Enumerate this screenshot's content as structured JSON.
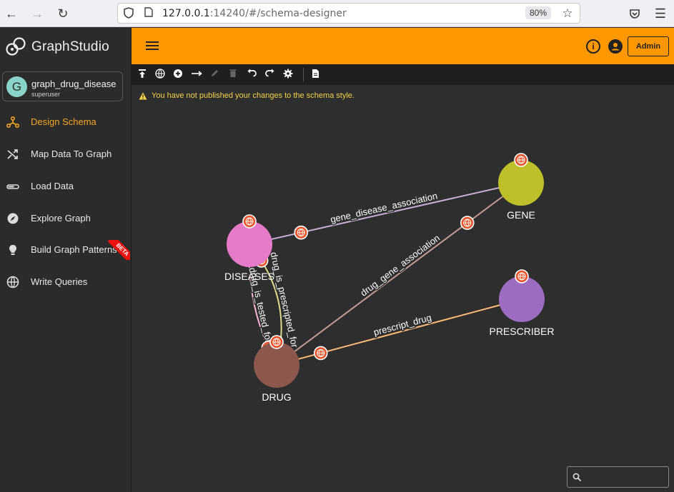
{
  "browser": {
    "url_host": "127.0.0.1",
    "url_port": ":14240",
    "url_path": "/#/schema-designer",
    "zoom": "80%"
  },
  "app": {
    "logo_prefix": "Graph",
    "logo_suffix": "Studio"
  },
  "graph": {
    "avatar_letter": "G",
    "name": "graph_drug_disease",
    "role": "superuser"
  },
  "sidebar": {
    "items": [
      {
        "label": "Design Schema",
        "icon": "schema-icon",
        "active": true
      },
      {
        "label": "Map Data To Graph",
        "icon": "shuffle-icon"
      },
      {
        "label": "Load Data",
        "icon": "load-icon"
      },
      {
        "label": "Explore Graph",
        "icon": "compass-icon"
      },
      {
        "label": "Build Graph Patterns",
        "icon": "lightbulb-icon",
        "badge": "BETA"
      },
      {
        "label": "Write Queries",
        "icon": "globe-icon"
      }
    ]
  },
  "header": {
    "admin_label": "Admin"
  },
  "toolbar": {
    "warning": "You have not published your changes to the schema style."
  },
  "schema": {
    "vertices": [
      {
        "id": "GENE",
        "label": "GENE",
        "color": "#bec02a"
      },
      {
        "id": "DISEASES",
        "label": "DISEASES",
        "color": "#e57ac8"
      },
      {
        "id": "PRESCRIBER",
        "label": "PRESCRIBER",
        "color": "#9b6cc0"
      },
      {
        "id": "DRUG",
        "label": "DRUG",
        "color": "#8c574c"
      }
    ],
    "edges": [
      {
        "label": "gene_disease_association",
        "from": "DISEASES",
        "to": "GENE",
        "color": "#c6b0d6"
      },
      {
        "label": "drug_gene_association",
        "from": "DRUG",
        "to": "GENE",
        "color": "#c49c94"
      },
      {
        "label": "prescript_drug",
        "from": "DRUG",
        "to": "PRESCRIBER",
        "color": "#ffbb78"
      },
      {
        "label": "drug_is_prescripted_for",
        "from": "DRUG",
        "to": "DISEASES",
        "color": "#dbdb8d"
      },
      {
        "label": "drug_is_tested_for",
        "from": "DRUG",
        "to": "DISEASES",
        "color": "#f7b6d2"
      }
    ]
  },
  "search": {
    "placeholder": ""
  }
}
